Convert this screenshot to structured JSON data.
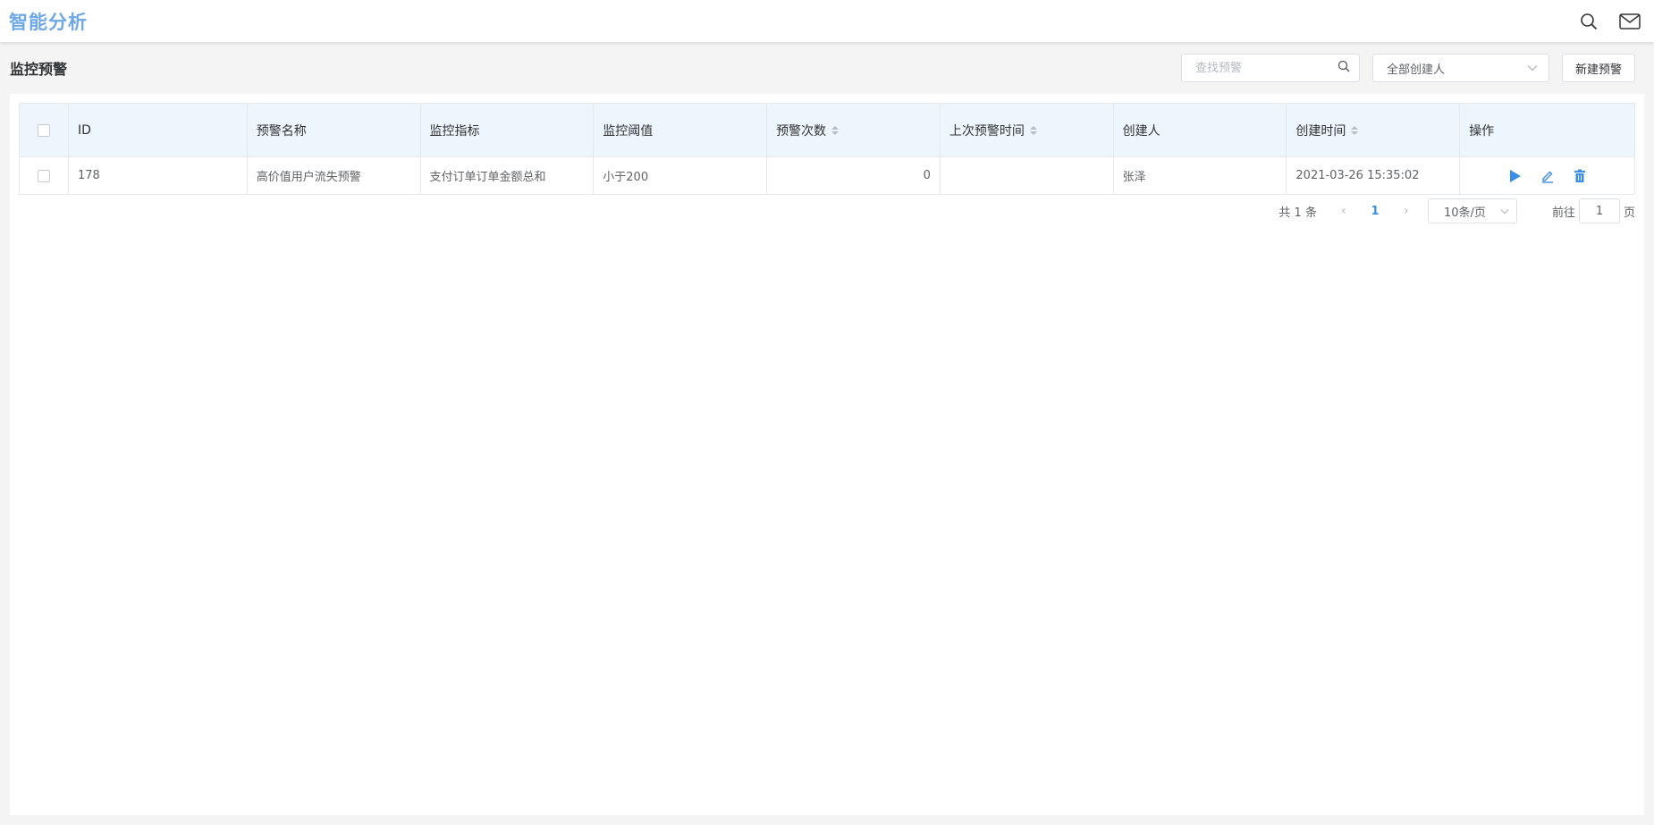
{
  "app": {
    "title": "智能分析"
  },
  "page": {
    "title": "监控预警"
  },
  "toolbar": {
    "search_placeholder": "查找预警",
    "search_value": "",
    "creator_select": "全部创建人",
    "new_button": "新建预警"
  },
  "table": {
    "columns": [
      "ID",
      "预警名称",
      "监控指标",
      "监控阈值",
      "预警次数",
      "上次预警时间",
      "创建人",
      "创建时间",
      "操作"
    ],
    "sortable": [
      "预警次数",
      "上次预警时间",
      "创建时间"
    ],
    "rows": [
      {
        "id": "178",
        "name": "高价值用户流失预警",
        "metric": "支付订单订单金额总和",
        "threshold": "小于200",
        "count": "0",
        "last_time": "",
        "creator": "张泽",
        "created": "2021-03-26 15:35:02"
      }
    ]
  },
  "pagination": {
    "total": "共 1 条",
    "current_page": "1",
    "page_size": "10条/页",
    "goto_label": "前往",
    "goto_value": "1",
    "page_suffix": "页"
  },
  "colors": {
    "brand": "#6fa8e6",
    "accent": "#3a8ee6",
    "header_bg": "#edf5fd"
  },
  "icons": [
    "search-icon",
    "mail-icon",
    "play-icon",
    "edit-icon",
    "delete-icon"
  ]
}
